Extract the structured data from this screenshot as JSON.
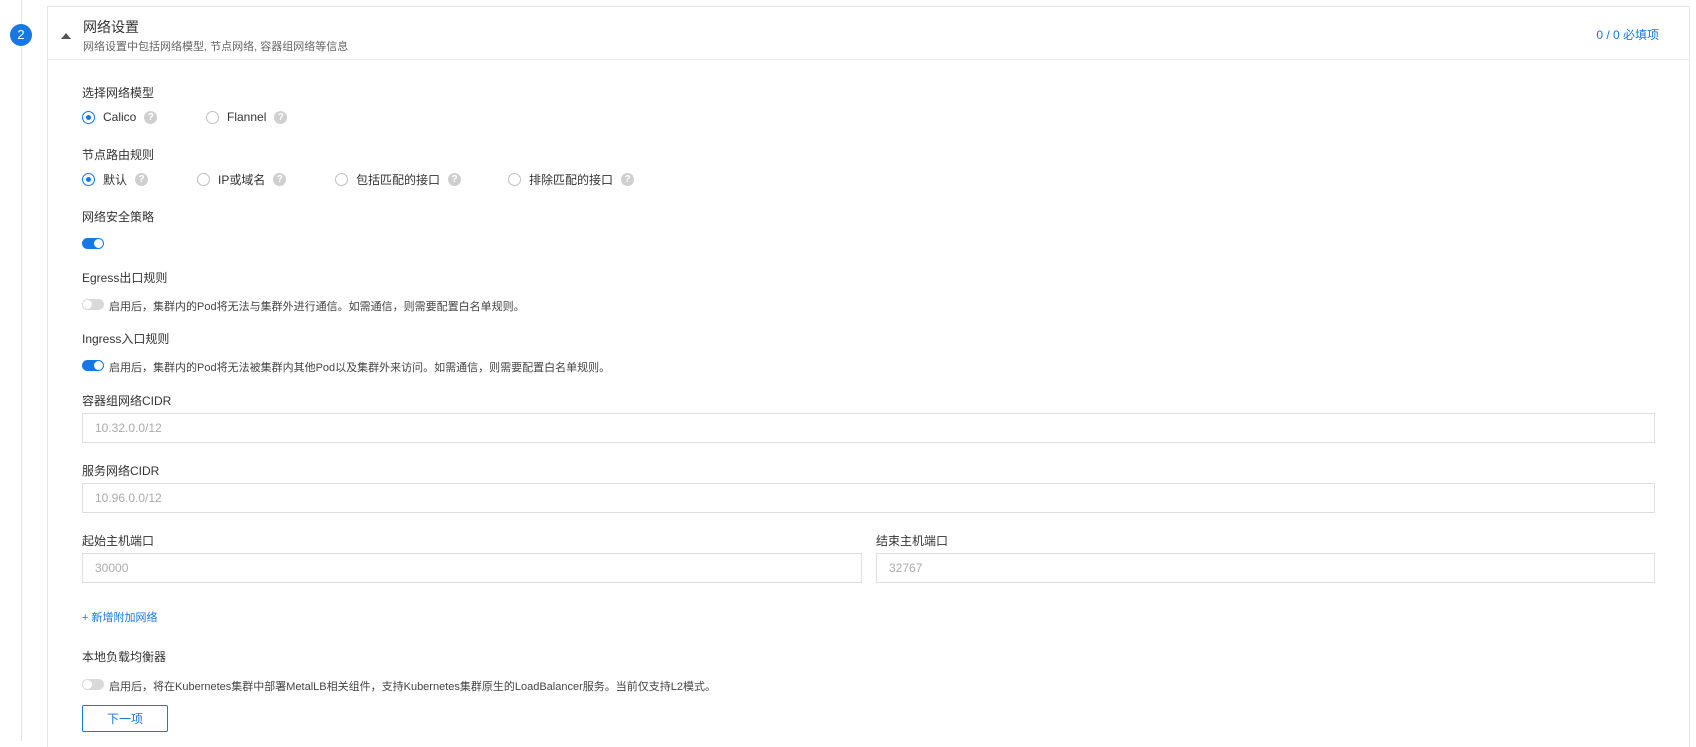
{
  "step": {
    "number": "2"
  },
  "section": {
    "title": "网络设置",
    "subtitle": "网络设置中包括网络模型, 节点网络, 容器组网络等信息",
    "required_count": "0 / 0 必填项"
  },
  "network_model": {
    "label": "选择网络模型",
    "options": [
      {
        "label": "Calico",
        "selected": true
      },
      {
        "label": "Flannel",
        "selected": false
      }
    ]
  },
  "node_route": {
    "label": "节点路由规则",
    "options": [
      {
        "label": "默认",
        "selected": true
      },
      {
        "label": "IP或域名",
        "selected": false
      },
      {
        "label": "包括匹配的接口",
        "selected": false
      },
      {
        "label": "排除匹配的接口",
        "selected": false
      }
    ]
  },
  "network_policy": {
    "label": "网络安全策略",
    "enabled": true
  },
  "egress": {
    "label": "Egress出口规则",
    "enabled": false,
    "description": "启用后，集群内的Pod将无法与集群外进行通信。如需通信，则需要配置白名单规则。"
  },
  "ingress": {
    "label": "Ingress入口规则",
    "enabled": true,
    "description": "启用后，集群内的Pod将无法被集群内其他Pod以及集群外来访问。如需通信，则需要配置白名单规则。"
  },
  "pod_cidr": {
    "label": "容器组网络CIDR",
    "placeholder": "10.32.0.0/12"
  },
  "service_cidr": {
    "label": "服务网络CIDR",
    "placeholder": "10.96.0.0/12"
  },
  "host_port_start": {
    "label": "起始主机端口",
    "placeholder": "30000"
  },
  "host_port_end": {
    "label": "结束主机端口",
    "placeholder": "32767"
  },
  "add_network": {
    "label": "+ 新增附加网络"
  },
  "local_lb": {
    "label": "本地负载均衡器",
    "enabled": false,
    "description": "启用后，将在Kubernetes集群中部署MetalLB相关组件，支持Kubernetes集群原生的LoadBalancer服务。当前仅支持L2模式。"
  },
  "next_button": {
    "label": "下一项"
  },
  "icons": {
    "help": "question-circle-icon",
    "collapse": "caret-up-icon"
  },
  "colors": {
    "accent": "#1677e6",
    "border": "#dedede",
    "toggle_off": "#d9d9d9"
  }
}
